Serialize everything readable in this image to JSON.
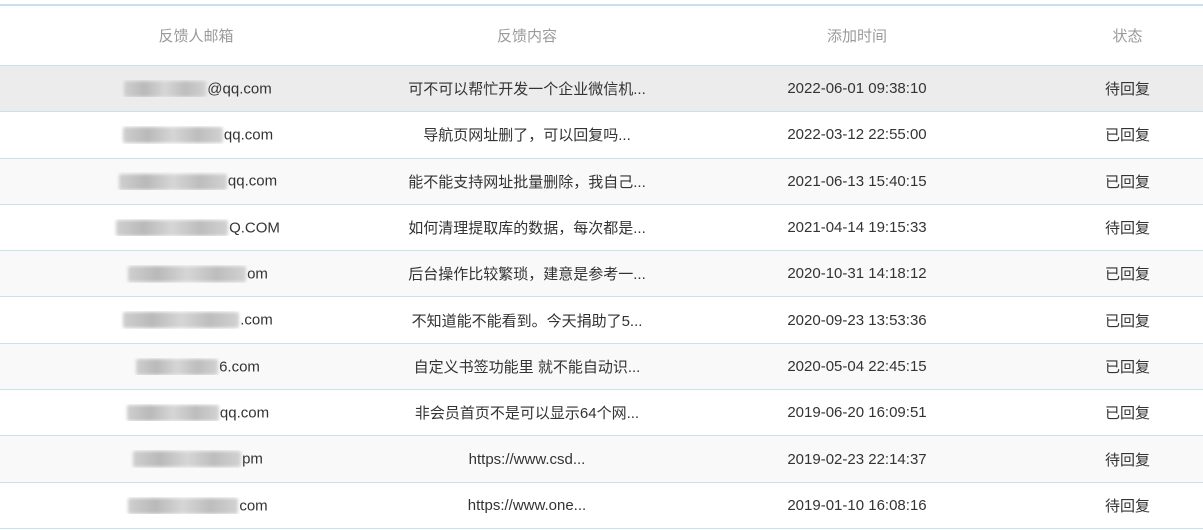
{
  "header": {
    "email": "反馈人邮箱",
    "content": "反馈内容",
    "time": "添加时间",
    "status": "状态"
  },
  "rows": [
    {
      "email_visible": "@qq.com",
      "content": "可不可以帮忙开发一个企业微信机...",
      "time": "2022-06-01 09:38:10",
      "status": "待回复"
    },
    {
      "email_visible": "qq.com",
      "content": "导航页网址删了，可以回复吗...",
      "time": "2022-03-12 22:55:00",
      "status": "已回复"
    },
    {
      "email_visible": "qq.com",
      "content": "能不能支持网址批量删除，我自己...",
      "time": "2021-06-13 15:40:15",
      "status": "已回复"
    },
    {
      "email_visible": "Q.COM",
      "content": "如何清理提取库的数据，每次都是...",
      "time": "2021-04-14 19:15:33",
      "status": "待回复"
    },
    {
      "email_visible": "om",
      "content": "后台操作比较繁琐，建意是参考一...",
      "time": "2020-10-31 14:18:12",
      "status": "已回复"
    },
    {
      "email_visible": ".com",
      "content": "不知道能不能看到。今天捐助了5...",
      "time": "2020-09-23 13:53:36",
      "status": "已回复"
    },
    {
      "email_visible": "6.com",
      "content": "自定义书签功能里 就不能自动识...",
      "time": "2020-05-04 22:45:15",
      "status": "已回复"
    },
    {
      "email_visible": "qq.com",
      "content": "非会员首页不是可以显示64个网...",
      "time": "2019-06-20 16:09:51",
      "status": "已回复"
    },
    {
      "email_visible": "pm",
      "content": "https://www.csd...",
      "time": "2019-02-23 22:14:37",
      "status": "待回复"
    },
    {
      "email_visible": "com",
      "content": "https://www.one...",
      "time": "2019-01-10 16:08:16",
      "status": "待回复"
    }
  ]
}
